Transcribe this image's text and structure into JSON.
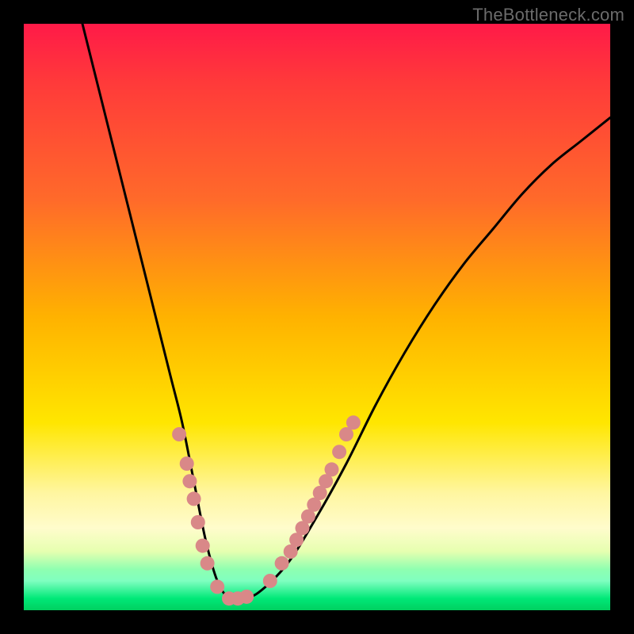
{
  "watermark": "TheBottleneck.com",
  "chart_data": {
    "type": "line",
    "title": "",
    "xlabel": "",
    "ylabel": "",
    "xlim": [
      0,
      100
    ],
    "ylim": [
      0,
      100
    ],
    "series": [
      {
        "name": "bottleneck-curve",
        "x": [
          10,
          12,
          15,
          18,
          20,
          22,
          25,
          27,
          29,
          31,
          33,
          35,
          37,
          40,
          45,
          50,
          55,
          60,
          65,
          70,
          75,
          80,
          85,
          90,
          95,
          100
        ],
        "y": [
          100,
          92,
          80,
          68,
          60,
          52,
          40,
          32,
          22,
          12,
          5,
          2,
          2,
          3,
          8,
          16,
          25,
          35,
          44,
          52,
          59,
          65,
          71,
          76,
          80,
          84
        ]
      }
    ],
    "markers": [
      {
        "name": "gpu-point",
        "x": 26.5,
        "y": 30
      },
      {
        "name": "gpu-point",
        "x": 27.8,
        "y": 25
      },
      {
        "name": "gpu-point",
        "x": 28.3,
        "y": 22
      },
      {
        "name": "gpu-point",
        "x": 29.0,
        "y": 19
      },
      {
        "name": "gpu-point",
        "x": 29.7,
        "y": 15
      },
      {
        "name": "gpu-point",
        "x": 30.5,
        "y": 11
      },
      {
        "name": "gpu-point",
        "x": 31.3,
        "y": 8
      },
      {
        "name": "gpu-point",
        "x": 33.0,
        "y": 4
      },
      {
        "name": "gpu-point",
        "x": 35.0,
        "y": 2
      },
      {
        "name": "gpu-point",
        "x": 36.5,
        "y": 2
      },
      {
        "name": "gpu-point",
        "x": 38.0,
        "y": 2.3
      },
      {
        "name": "gpu-point",
        "x": 42.0,
        "y": 5
      },
      {
        "name": "gpu-point",
        "x": 44.0,
        "y": 8
      },
      {
        "name": "gpu-point",
        "x": 45.5,
        "y": 10
      },
      {
        "name": "gpu-point",
        "x": 46.5,
        "y": 12
      },
      {
        "name": "gpu-point",
        "x": 47.5,
        "y": 14
      },
      {
        "name": "gpu-point",
        "x": 48.5,
        "y": 16
      },
      {
        "name": "gpu-point",
        "x": 49.5,
        "y": 18
      },
      {
        "name": "gpu-point",
        "x": 50.5,
        "y": 20
      },
      {
        "name": "gpu-point",
        "x": 51.5,
        "y": 22
      },
      {
        "name": "gpu-point",
        "x": 52.5,
        "y": 24
      },
      {
        "name": "gpu-point",
        "x": 53.8,
        "y": 27
      },
      {
        "name": "gpu-point",
        "x": 55.0,
        "y": 30
      },
      {
        "name": "gpu-point",
        "x": 56.2,
        "y": 32
      }
    ],
    "gradient_stops": [
      {
        "pos": 0,
        "color": "#ff1a48"
      },
      {
        "pos": 10,
        "color": "#ff3a3a"
      },
      {
        "pos": 30,
        "color": "#ff6a2a"
      },
      {
        "pos": 50,
        "color": "#ffb200"
      },
      {
        "pos": 68,
        "color": "#ffe600"
      },
      {
        "pos": 80,
        "color": "#fff6a0"
      },
      {
        "pos": 86,
        "color": "#fffccc"
      },
      {
        "pos": 90,
        "color": "#e6ffb0"
      },
      {
        "pos": 93,
        "color": "#8fffb0"
      },
      {
        "pos": 95,
        "color": "#7fffc0"
      },
      {
        "pos": 98,
        "color": "#00e878"
      },
      {
        "pos": 100,
        "color": "#00d060"
      }
    ],
    "marker_color": "#d98888",
    "curve_color": "#000000"
  }
}
